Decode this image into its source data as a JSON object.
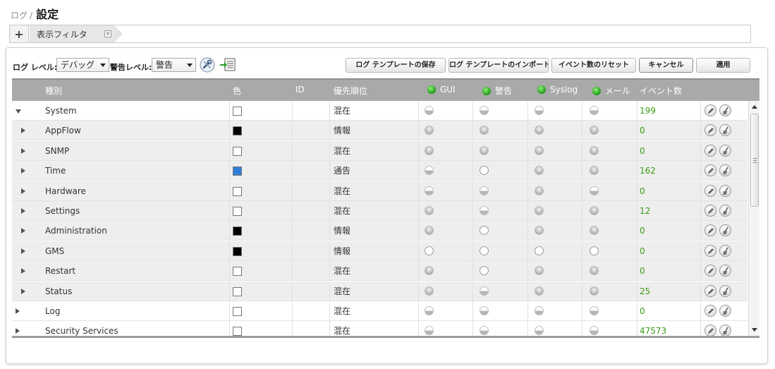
{
  "breadcrumb": {
    "parent": "ログ",
    "separator": "/",
    "current": "設定"
  },
  "filter_bar": {
    "add_label": "+",
    "tab_label": "表示フィルタ",
    "close_label": "×"
  },
  "toolbar": {
    "log_level_label": "ログ レベル:",
    "log_level_value": "デバッグ",
    "alert_level_label": "警告レベル:",
    "alert_level_value": "警告",
    "icons": [
      "wrench-icon",
      "export-list-icon"
    ],
    "buttons": {
      "save_template": "ログ テンプレートの保存",
      "import_template": "ログ テンプレートのインポート",
      "reset_counts": "イベント数のリセット",
      "cancel": "キャンセル",
      "apply": "適用"
    }
  },
  "table": {
    "headers": {
      "category": "種別",
      "color": "色",
      "id": "ID",
      "priority": "優先順位",
      "gui": "GUI",
      "alert": "警告",
      "syslog": "Syslog",
      "mail": "メール",
      "event_count": "イベント数"
    },
    "rows": [
      {
        "name": "System",
        "level": "top",
        "expanded": true,
        "color": "#ffffff",
        "priority": "混在",
        "gui": "half",
        "alert": "half",
        "syslog": "half",
        "mail": "half",
        "count": "199"
      },
      {
        "name": "AppFlow",
        "level": "sub",
        "expanded": false,
        "color": "#000000",
        "priority": "情報",
        "gui": "gray",
        "alert": "gray",
        "syslog": "gray",
        "mail": "gray",
        "count": "0"
      },
      {
        "name": "SNMP",
        "level": "sub",
        "expanded": false,
        "color": "#ffffff",
        "priority": "混在",
        "gui": "gray",
        "alert": "gray",
        "syslog": "gray",
        "mail": "gray",
        "count": "0"
      },
      {
        "name": "Time",
        "level": "sub",
        "expanded": false,
        "color": "#2f7fd8",
        "priority": "通告",
        "gui": "half",
        "alert": "empty",
        "syslog": "gray",
        "mail": "gray",
        "count": "162"
      },
      {
        "name": "Hardware",
        "level": "sub",
        "expanded": false,
        "color": "#ffffff",
        "priority": "混在",
        "gui": "half",
        "alert": "half",
        "syslog": "gray",
        "mail": "half",
        "count": "0"
      },
      {
        "name": "Settings",
        "level": "sub",
        "expanded": false,
        "color": "#ffffff",
        "priority": "混在",
        "gui": "gray",
        "alert": "half",
        "syslog": "gray",
        "mail": "gray",
        "count": "12"
      },
      {
        "name": "Administration",
        "level": "sub",
        "expanded": false,
        "color": "#000000",
        "priority": "情報",
        "gui": "gray",
        "alert": "empty",
        "syslog": "gray",
        "mail": "gray",
        "count": "0"
      },
      {
        "name": "GMS",
        "level": "sub",
        "expanded": false,
        "color": "#000000",
        "priority": "情報",
        "gui": "empty",
        "alert": "empty",
        "syslog": "empty",
        "mail": "empty",
        "count": "0"
      },
      {
        "name": "Restart",
        "level": "sub",
        "expanded": false,
        "color": "#ffffff",
        "priority": "混在",
        "gui": "gray",
        "alert": "empty",
        "syslog": "gray",
        "mail": "gray",
        "count": "0"
      },
      {
        "name": "Status",
        "level": "sub",
        "expanded": false,
        "color": "#ffffff",
        "priority": "混在",
        "gui": "gray",
        "alert": "half",
        "syslog": "gray",
        "mail": "gray",
        "count": "25"
      },
      {
        "name": "Log",
        "level": "top",
        "expanded": false,
        "color": "#ffffff",
        "priority": "混在",
        "gui": "half",
        "alert": "half",
        "syslog": "half",
        "mail": "half",
        "count": "0"
      },
      {
        "name": "Security Services",
        "level": "top",
        "expanded": false,
        "color": "#ffffff",
        "priority": "混在",
        "gui": "half",
        "alert": "half",
        "syslog": "half",
        "mail": "half",
        "count": "47573"
      }
    ]
  },
  "colors": {
    "header_bg": "#a9a9a9",
    "count_green": "#3b9a12",
    "status_green": "#1c9a10"
  }
}
